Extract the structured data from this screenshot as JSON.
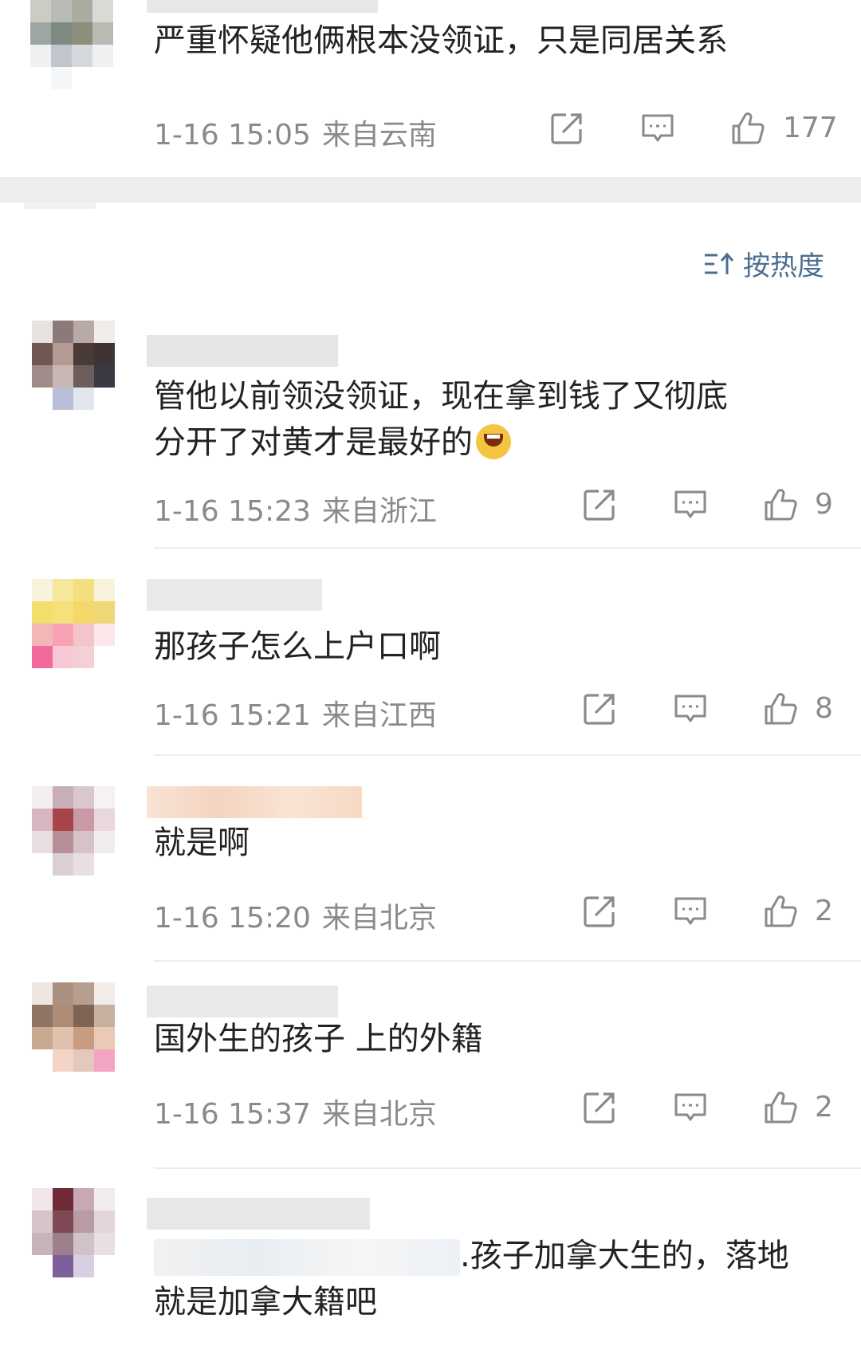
{
  "first_comment": {
    "text": "严重怀疑他俩根本没领证，只是同居关系",
    "time": "1-16 15:05",
    "location": "来自云南",
    "likes": "177"
  },
  "sort": {
    "label": "按热度"
  },
  "comments": [
    {
      "text_line1": "管他以前领没领证，现在拿到钱了又彻底",
      "text_line2": "分开了对黄才是最好的",
      "time": "1-16 15:23",
      "location": "来自浙江",
      "likes": "9"
    },
    {
      "text_line1": "那孩子怎么上户口啊",
      "time": "1-16 15:21",
      "location": "来自江西",
      "likes": "8"
    },
    {
      "text_line1": "就是啊",
      "time": "1-16 15:20",
      "location": "来自北京",
      "likes": "2"
    },
    {
      "text_line1": "国外生的孩子 上的外籍",
      "time": "1-16 15:37",
      "location": "来自北京",
      "likes": "2"
    },
    {
      "text_line1": ".孩子加拿大生的，落地",
      "text_line2": "就是加拿大籍吧"
    }
  ],
  "icons": {
    "share": "share-icon",
    "comment": "comment-icon",
    "like": "thumbs-up-icon",
    "sort": "sort-icon"
  },
  "colors": {
    "accent": "#4b6f92",
    "meta_text": "#8a8a8a",
    "divider": "#ececec",
    "gap": "#ededed"
  }
}
